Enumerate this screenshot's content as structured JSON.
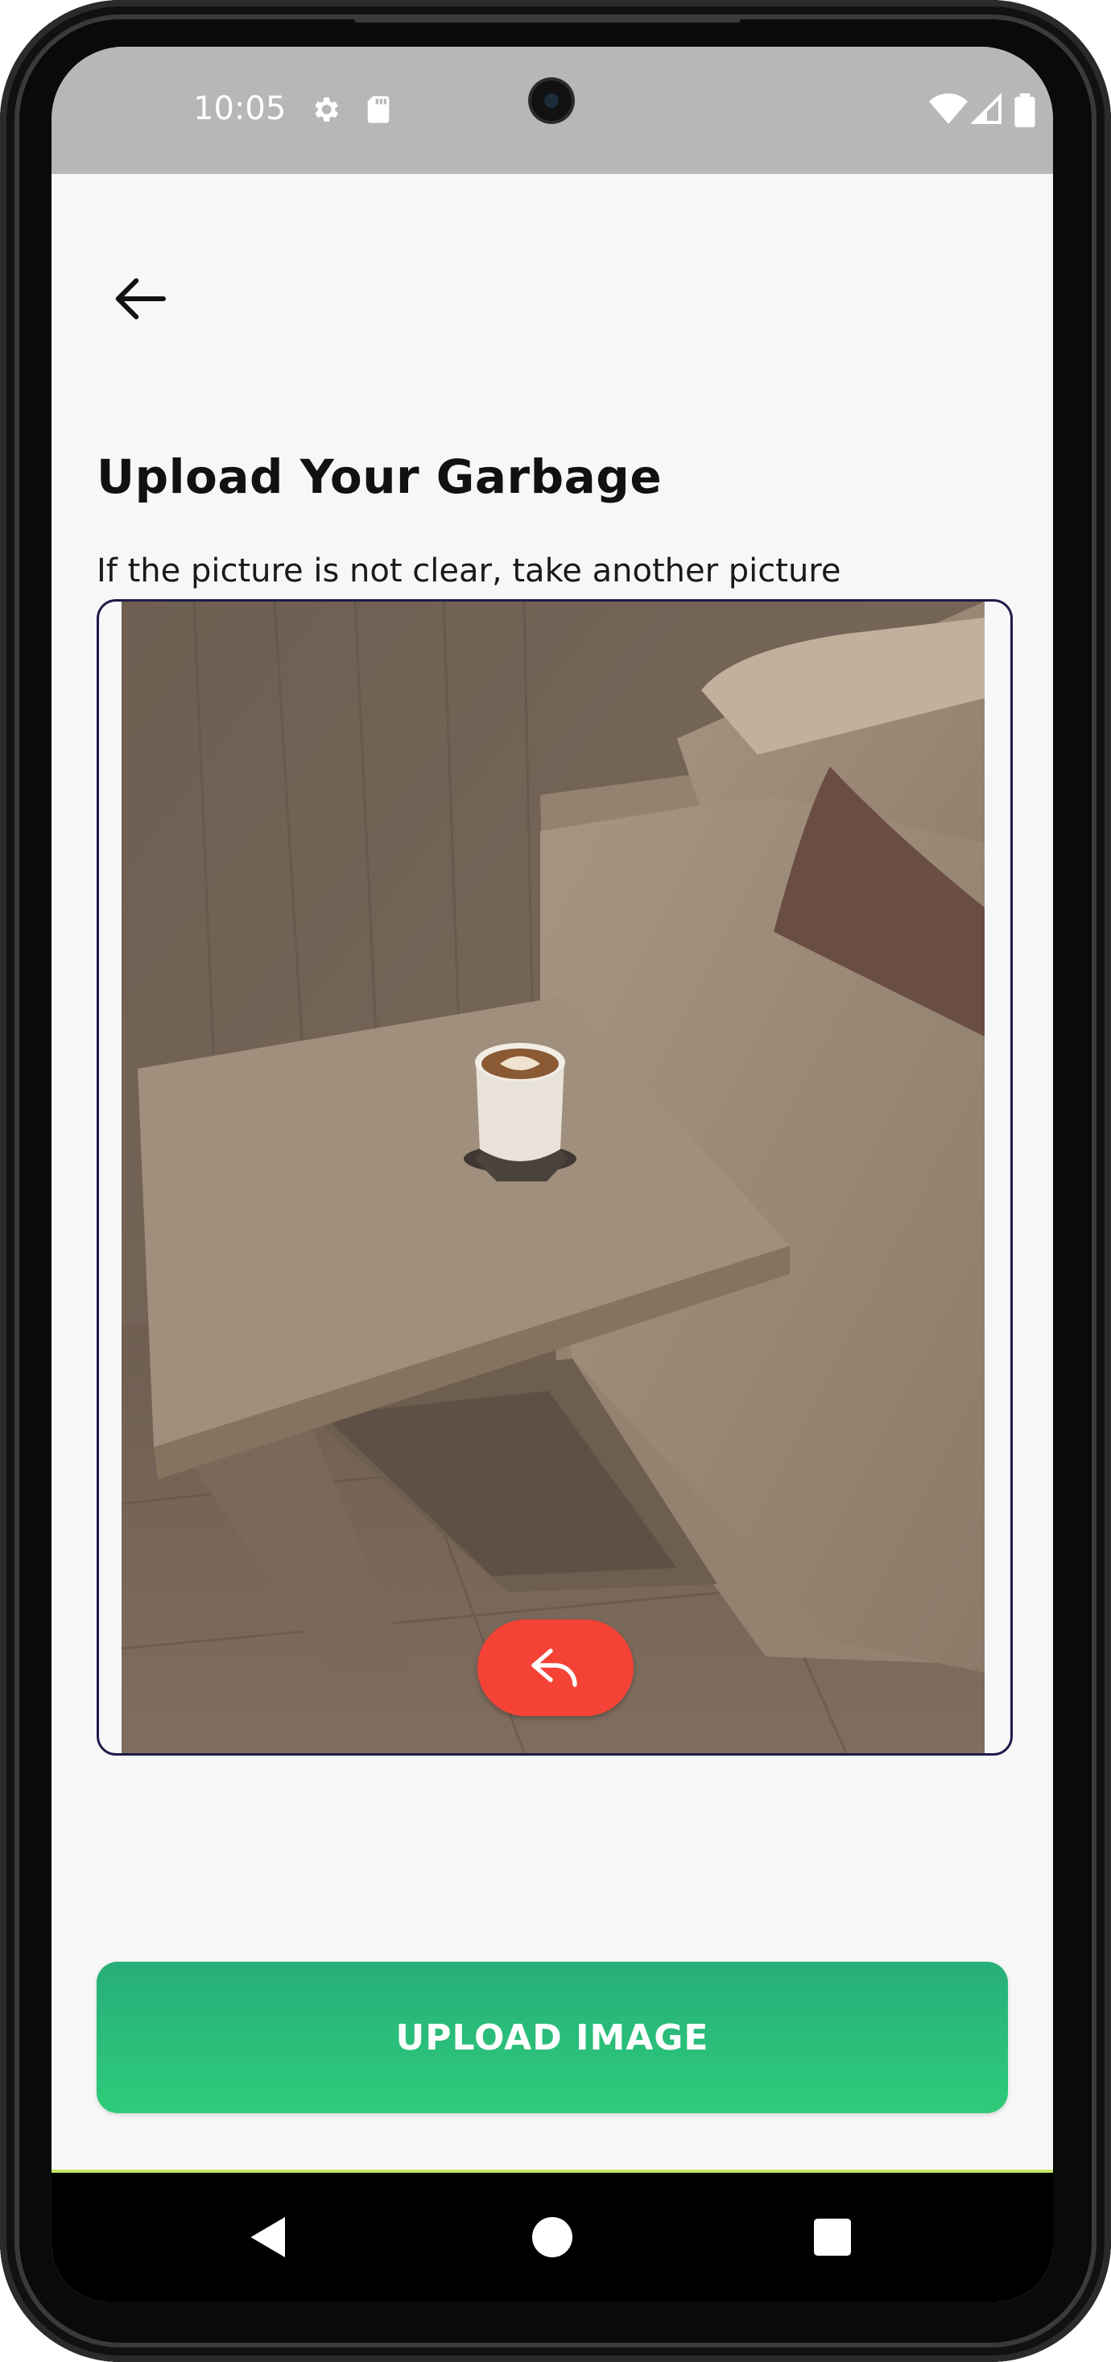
{
  "status_bar": {
    "time": "10:05",
    "icons": [
      "gear-icon",
      "sd-card-icon",
      "wifi-icon",
      "signal-icon",
      "battery-icon"
    ]
  },
  "header": {
    "back_icon": "arrow-left-icon",
    "title": "Upload Your Garbage",
    "subtitle": "If the picture is not clear, take another picture"
  },
  "preview": {
    "retake_icon": "undo-arrow-icon",
    "retake_color": "#f44336",
    "frame_border_color": "#1f1b4a"
  },
  "actions": {
    "upload_label": "UPLOAD IMAGE",
    "upload_color": "#2ecc7a"
  },
  "nav_bar": {
    "buttons": [
      "back-triangle-icon",
      "home-circle-icon",
      "recents-square-icon"
    ]
  }
}
